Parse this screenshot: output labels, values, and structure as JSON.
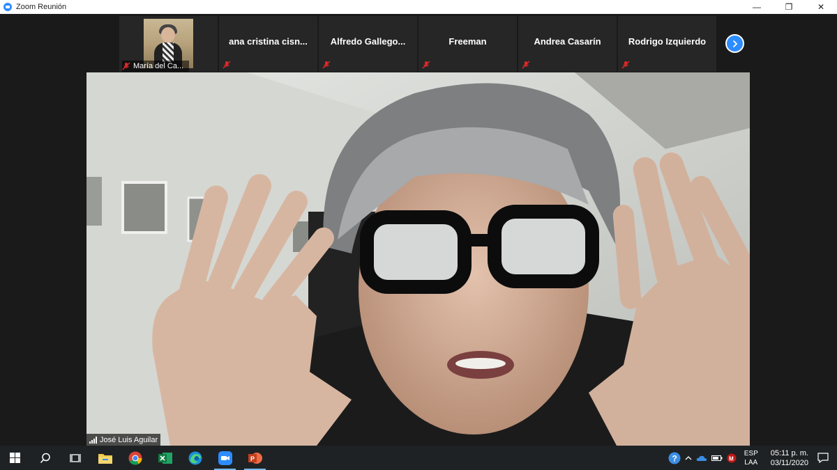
{
  "window": {
    "title": "Zoom Reunión",
    "minimize": "—",
    "restore": "❐",
    "close": "✕"
  },
  "gallery": {
    "participants": [
      {
        "name": "María del Ca..."
      },
      {
        "name": "ana  cristina  cisn..."
      },
      {
        "name": "Alfredo  Gallego..."
      },
      {
        "name": "Freeman"
      },
      {
        "name": "Andrea Casarín"
      },
      {
        "name": "Rodrigo Izquierdo"
      }
    ]
  },
  "main_video": {
    "speaker_name": "José Luis Aguilar"
  },
  "taskbar": {
    "apps": [
      "start-icon",
      "search-icon",
      "task-view-icon",
      "file-explorer-icon",
      "chrome-icon",
      "excel-icon",
      "edge-icon",
      "zoom-icon",
      "powerpoint-icon"
    ],
    "language_line1": "ESP",
    "language_line2": "LAA",
    "time": "05:11 p. m.",
    "date": "03/11/2020"
  },
  "colors": {
    "zoom_blue": "#2d8cff",
    "mute_red": "#e02828",
    "taskbar": "#1f2224"
  }
}
